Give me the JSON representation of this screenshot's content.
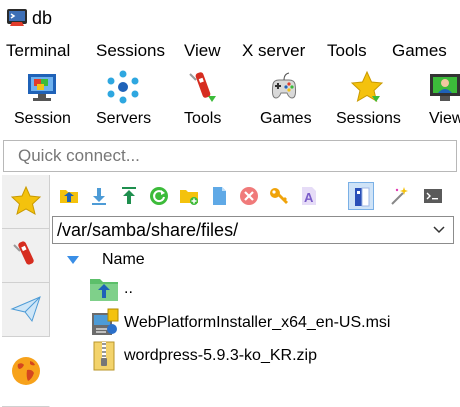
{
  "window": {
    "title": "db"
  },
  "menu": [
    "Terminal",
    "Sessions",
    "View",
    "X server",
    "Tools",
    "Games"
  ],
  "toolbar": [
    {
      "label": "Session",
      "icon": "session-icon"
    },
    {
      "label": "Servers",
      "icon": "servers-icon"
    },
    {
      "label": "Tools",
      "icon": "tools-icon"
    },
    {
      "label": "Games",
      "icon": "games-icon"
    },
    {
      "label": "Sessions",
      "icon": "star-icon"
    },
    {
      "label": "View",
      "icon": "view-icon"
    }
  ],
  "quick_connect": {
    "placeholder": "Quick connect..."
  },
  "sidebar_tabs": [
    "star-icon",
    "tools-icon",
    "paper-plane-icon",
    "globe-icon"
  ],
  "sftp": {
    "toolbar_icons": [
      "parent-directory-icon",
      "download-icon",
      "upload-icon",
      "refresh-icon",
      "new-folder-icon",
      "new-file-icon",
      "delete-icon",
      "permissions-key-icon",
      "text-mode-icon",
      "split-view-icon",
      "magic-wand-icon",
      "terminal-icon"
    ],
    "path": "/var/samba/share/files/",
    "column_header": "Name",
    "files": [
      {
        "name": "..",
        "icon": "parent-folder-icon"
      },
      {
        "name": "WebPlatformInstaller_x64_en-US.msi",
        "icon": "msi-installer-icon"
      },
      {
        "name": "wordpress-5.9.3-ko_KR.zip",
        "icon": "zip-archive-icon"
      }
    ]
  }
}
